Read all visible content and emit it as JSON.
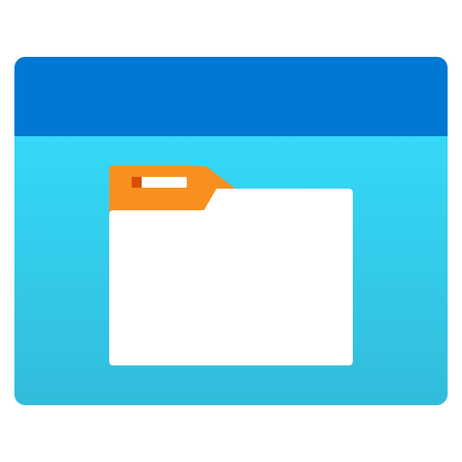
{
  "app_icon": {
    "icon_name": "file-explorer-icon",
    "titlebar_color": "#0078D4",
    "body_gradient": [
      "#35D8F8",
      "#32BCDC"
    ],
    "folder": {
      "icon_name": "folder-icon",
      "tab_color": "#F7901E",
      "sheet_color": "#FFFFFF",
      "label_mark_color": "#D94F00"
    }
  }
}
